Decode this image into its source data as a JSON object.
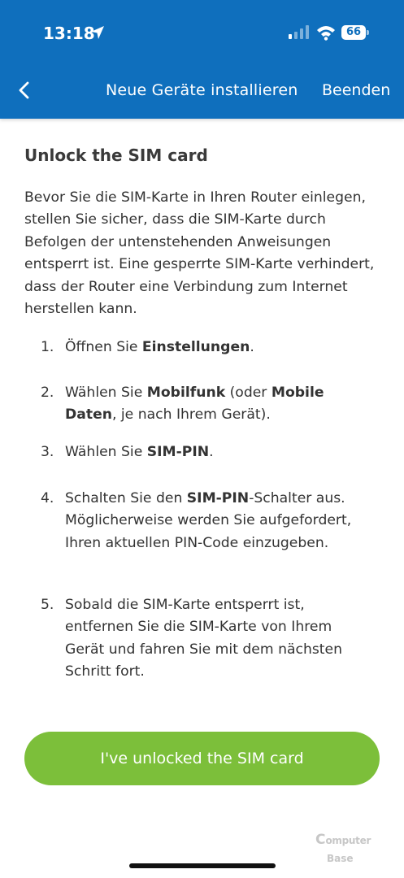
{
  "status_bar": {
    "time": "13:18",
    "battery": "66",
    "icons": [
      "location-arrow-icon",
      "cellular-signal-icon",
      "wifi-icon",
      "battery-icon"
    ]
  },
  "nav": {
    "back_icon": "chevron-left-icon",
    "title": "Neue Geräte installieren",
    "end_label": "Beenden"
  },
  "page": {
    "heading": "Unlock the SIM card",
    "intro": "Bevor Sie die SIM-Karte in Ihren Router einlegen, stellen Sie sicher, dass die SIM-Karte durch Befolgen der untenstehenden Anweisungen entsperrt ist. Eine gesperrte SIM-Karte verhindert, dass der Router eine Verbindung zum Internet herstellen kann.",
    "steps": [
      {
        "num": "1.",
        "parts": [
          {
            "t": "Öffnen Sie "
          },
          {
            "b": "Einstellungen"
          },
          {
            "t": "."
          }
        ]
      },
      {
        "num": "2.",
        "parts": [
          {
            "t": "Wählen Sie "
          },
          {
            "b": "Mobilfunk"
          },
          {
            "t": " (oder "
          },
          {
            "b": "Mobile Daten"
          },
          {
            "t": ", je nach Ihrem Gerät)."
          }
        ]
      },
      {
        "num": "3.",
        "parts": [
          {
            "t": "Wählen Sie "
          },
          {
            "b": "SIM-PIN"
          },
          {
            "t": "."
          }
        ]
      },
      {
        "num": "4.",
        "parts": [
          {
            "t": "Schalten Sie den "
          },
          {
            "b": "SIM-PIN"
          },
          {
            "t": "-Schalter aus. Möglicherweise werden Sie aufgefordert, Ihren aktuellen PIN-Code einzugeben."
          }
        ]
      },
      {
        "num": "5.",
        "parts": [
          {
            "t": "Sobald die SIM-Karte entsperrt ist, entfernen Sie die SIM-Karte von Ihrem Gerät und fahren Sie mit dem nächsten Schritt fort."
          }
        ]
      }
    ],
    "cta_label": "I've unlocked the SIM card"
  },
  "watermark": "ComputerBase",
  "colors": {
    "header_bg": "#0f6fbd",
    "cta_bg": "#7cbf3a",
    "text": "#333333"
  }
}
